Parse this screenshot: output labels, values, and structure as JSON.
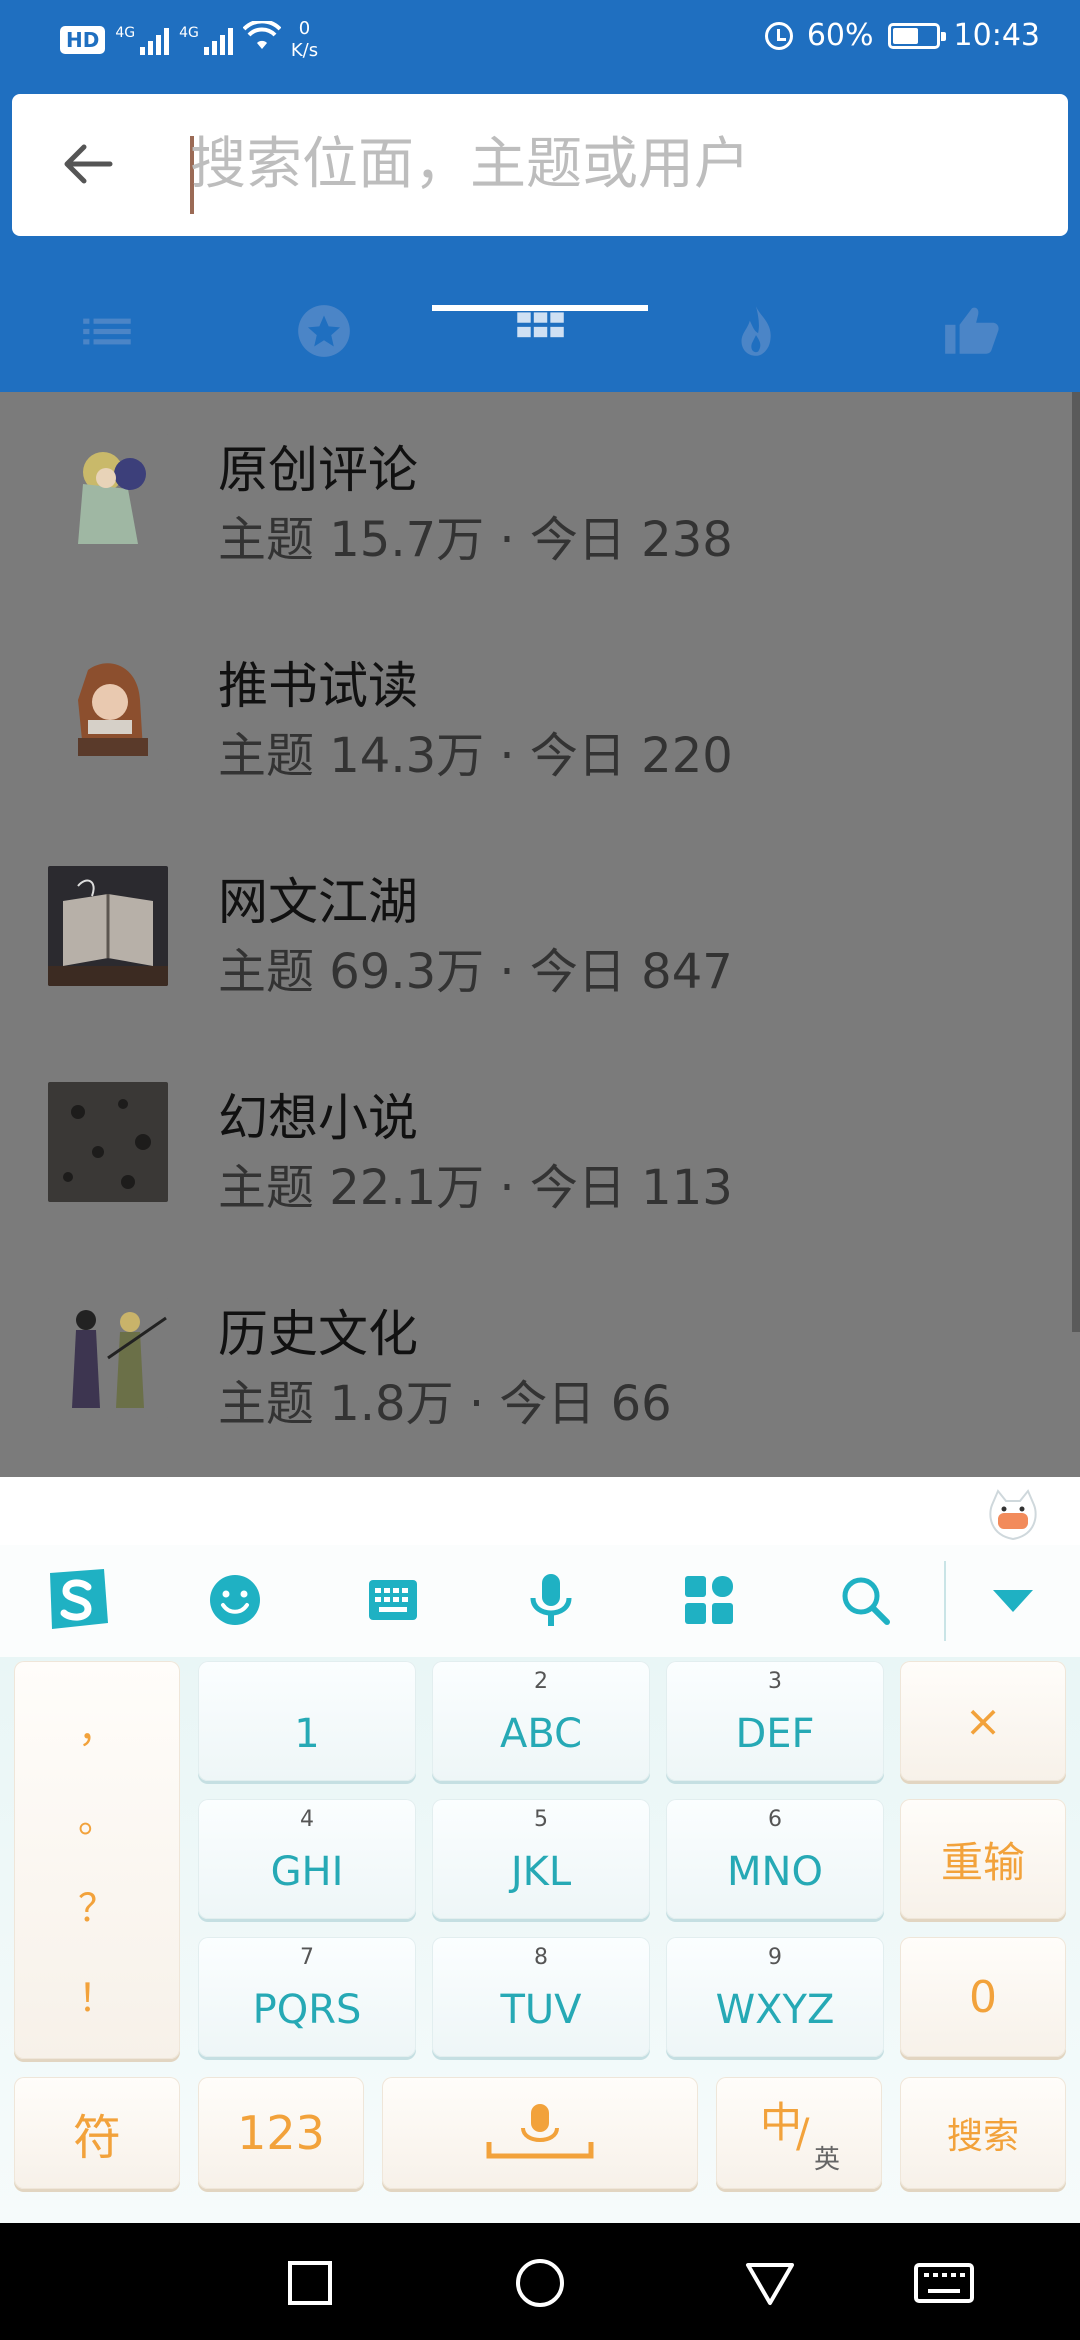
{
  "status_bar": {
    "hd": "HD",
    "net1": "4G",
    "net2": "4G",
    "speed_value": "0",
    "speed_unit": "K/s",
    "battery": "60%",
    "battery_level": 0.6,
    "time": "10:43"
  },
  "search": {
    "placeholder": "搜索位面，主题或用户",
    "value": ""
  },
  "tabs": [
    {
      "icon": "list-icon"
    },
    {
      "icon": "star-icon"
    },
    {
      "icon": "grid-icon",
      "active": true
    },
    {
      "icon": "flame-icon"
    },
    {
      "icon": "thumbs-up-icon"
    }
  ],
  "forums": [
    {
      "title": "原创评论",
      "meta": "主题 15.7万 · 今日 238"
    },
    {
      "title": "推书试读",
      "meta": "主题 14.3万 · 今日 220"
    },
    {
      "title": "网文江湖",
      "meta": "主题 69.3万 · 今日 847"
    },
    {
      "title": "幻想小说",
      "meta": "主题 22.1万 · 今日 113"
    },
    {
      "title": "历史文化",
      "meta": "主题 1.8万 · 今日 66"
    }
  ],
  "keyboard": {
    "punct": [
      "，",
      "。",
      "？",
      "！"
    ],
    "keys": [
      {
        "num": "",
        "label": "1"
      },
      {
        "num": "2",
        "label": "ABC"
      },
      {
        "num": "3",
        "label": "DEF"
      },
      {
        "num": "4",
        "label": "GHI"
      },
      {
        "num": "5",
        "label": "JKL"
      },
      {
        "num": "6",
        "label": "MNO"
      },
      {
        "num": "7",
        "label": "PQRS"
      },
      {
        "num": "8",
        "label": "TUV"
      },
      {
        "num": "9",
        "label": "WXYZ"
      }
    ],
    "delete": "×",
    "reenter": "重输",
    "zero": "0",
    "symbols": "符",
    "numbers": "123",
    "lang_zh": "中",
    "lang_en": "英",
    "search": "搜索"
  },
  "colors": {
    "primary": "#1f6fc0",
    "key_text": "#26a9b5",
    "func_text": "#f2a23b"
  }
}
